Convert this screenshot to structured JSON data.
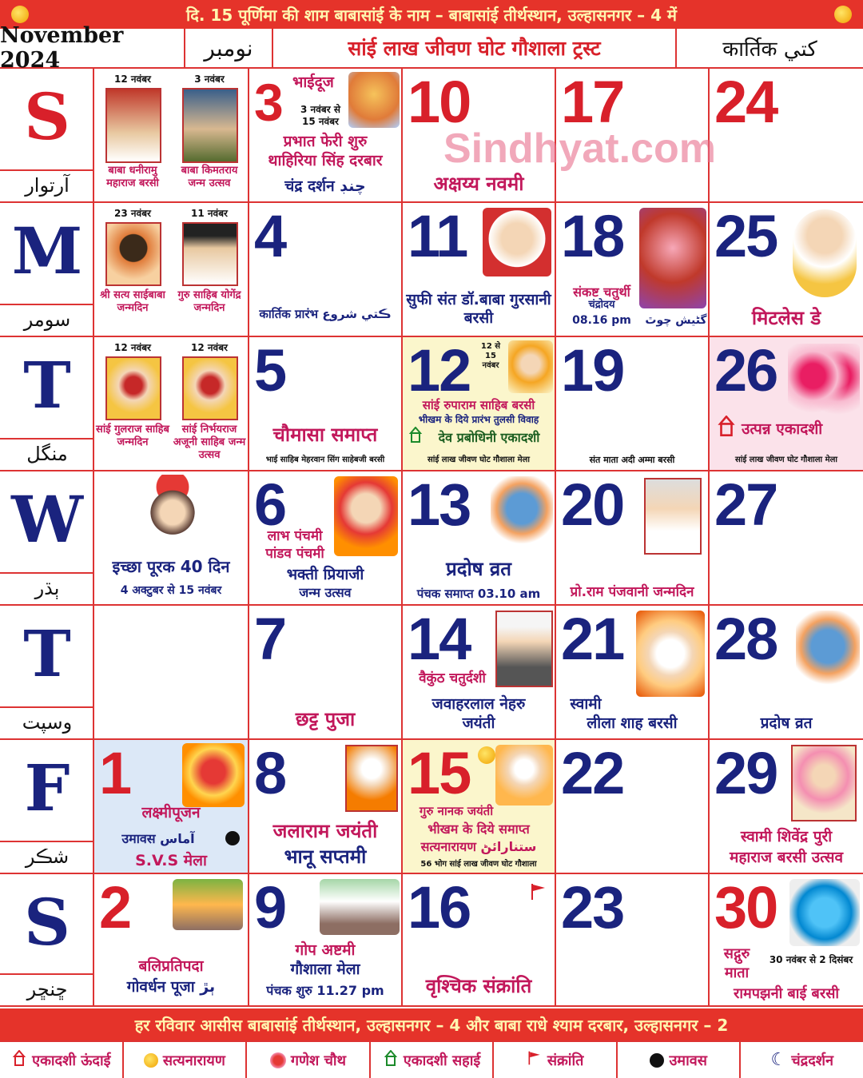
{
  "top_banner": "दि. 15 पूर्णिमा की शाम बाबासांई के नाम – बाबासांई तीर्थस्थान, उल्हासनगर – 4 में",
  "header": {
    "month": "November 2024",
    "month_urdu": "نومبر",
    "trust": "सांई लाख जीवण घोट गौशाला ट्रस्ट",
    "kartik": "कार्तिक كتي"
  },
  "watermark": "Sindhyat.com",
  "days": [
    {
      "letter": "S",
      "urdu": "آرتوار",
      "color": "#d8202a"
    },
    {
      "letter": "M",
      "urdu": "سومر",
      "color": "#1a237e"
    },
    {
      "letter": "T",
      "urdu": "منگل",
      "color": "#1a237e"
    },
    {
      "letter": "W",
      "urdu": "ٻڌر",
      "color": "#1a237e"
    },
    {
      "letter": "T",
      "urdu": "وسپت",
      "color": "#1a237e"
    },
    {
      "letter": "F",
      "urdu": "شڪر",
      "color": "#1a237e"
    },
    {
      "letter": "S",
      "urdu": "ڇنڇر",
      "color": "#1a237e"
    }
  ],
  "minis": {
    "sun": [
      {
        "date": "12 नवंबर",
        "caption": "बाबा धनीरामु महाराज बरसी"
      },
      {
        "date": "3 नवंबर",
        "caption": "बाबा किमतराय जन्म उत्सव"
      }
    ],
    "mon": [
      {
        "date": "23 नवंबर",
        "caption": "श्री सत्य साईबाबा जन्मदिन"
      },
      {
        "date": "11 नवंबर",
        "caption": "गुरु साहिब योगेंद्र जन्मदिन"
      }
    ],
    "tue": [
      {
        "date": "12 नवंबर",
        "caption": "सांई गुलराज साहिब जन्मदिन"
      },
      {
        "date": "12 नवंबर",
        "caption": "सांई निर्भयराज अजूनी साहिब जन्म उत्सव"
      }
    ]
  },
  "cells": {
    "d3": {
      "num": "3",
      "a": "भाईदूज",
      "b": "3 नवंबर से 15 नवंबर",
      "c": "प्रभात फेरी शुरु",
      "d": "थाहिरिया सिंह दरबार",
      "e": "चंद्र दर्शन چنڊ"
    },
    "d10": {
      "num": "10",
      "a": "अक्षय्य नवमी"
    },
    "d17": {
      "num": "17"
    },
    "d24": {
      "num": "24"
    },
    "d4": {
      "num": "4",
      "a": "कार्तिक प्रारंभ ڪتي شروع"
    },
    "d11": {
      "num": "11",
      "a": "सुफी संत डॉ.बाबा गुरसानी बरसी"
    },
    "d18": {
      "num": "18",
      "a": "संकष्ट चतुर्थी",
      "b": "चंद्रोदय",
      "c": "08.16 pm",
      "d": "گڻيش چوٿ"
    },
    "d25": {
      "num": "25",
      "a": "मिटलेस डे"
    },
    "d5": {
      "num": "5",
      "a": "चौमासा समाप्त",
      "b": "भाई साहिब मेहरवान सिंग साहेबजी बरसी"
    },
    "d12": {
      "num": "12",
      "sub": "12 से 15 नवंबर",
      "a": "सांई रुपाराम साहिब बरसी",
      "b": "भीखम के दिये प्रारंभ तुलसी विवाह",
      "c": "देव प्रबोधिनी एकादशी",
      "d": "सांई लाख जीवण घोट गौशाला मेला"
    },
    "d19": {
      "num": "19",
      "a": "संत माता अदी अम्मा बरसी"
    },
    "d26": {
      "num": "26",
      "a": "उत्पन्न एकादशी",
      "b": "सांई लाख जीवण घोट गौशाला मेला"
    },
    "wmini": {
      "a": "इच्छा पूरक 40 दिन",
      "b": "4 अक्टुबर से 15 नवंबर"
    },
    "d6": {
      "num": "6",
      "a": "लाभ पंचमी",
      "b": "पांडव पंचमी",
      "c": "भक्ती प्रियाजी",
      "d": "जन्म उत्सव"
    },
    "d13": {
      "num": "13",
      "a": "प्रदोष व्रत",
      "b": "पंचक समाप्त 03.10 am"
    },
    "d20": {
      "num": "20",
      "a": "प्रो.राम पंजवानी जन्मदिन"
    },
    "d27": {
      "num": "27"
    },
    "d7": {
      "num": "7",
      "a": "छट्ट पुजा"
    },
    "d14": {
      "num": "14",
      "a": "वैकुंठ चतुर्दशी",
      "b": "जवाहरलाल नेहरु",
      "c": "जयंती"
    },
    "d21": {
      "num": "21",
      "a": "स्वामी",
      "b": "लीला शाह बरसी"
    },
    "d28": {
      "num": "28",
      "a": "प्रदोष व्रत"
    },
    "d1": {
      "num": "1",
      "a": "लक्ष्मीपूजन",
      "b": "उमावस آماس",
      "c": "S.V.S मेला"
    },
    "d8": {
      "num": "8",
      "a": "जलाराम जयंती",
      "b": "भानू सप्तमी"
    },
    "d15": {
      "num": "15",
      "a": "गुरु नानक जयंती",
      "b": "भीखम के दिये समाप्त",
      "c": "सत्यनारायण ستنارائڻ",
      "d": "56 भोग सांई लाख जीवण घोट गौशाला"
    },
    "d22": {
      "num": "22"
    },
    "d29": {
      "num": "29",
      "a": "स्वामी शिवेंद्र पुरी",
      "b": "महाराज बरसी उत्सव"
    },
    "d2": {
      "num": "2",
      "a": "बलिप्रतिपदा",
      "b": "गोवर्धन पूजा ٻڙ"
    },
    "d9": {
      "num": "9",
      "a": "गोप अष्टमी",
      "b": "गौशाला मेला",
      "c": "पंचक शुरु 11.27 pm"
    },
    "d16": {
      "num": "16",
      "a": "वृश्चिक संक्रांति"
    },
    "d23": {
      "num": "23"
    },
    "d30": {
      "num": "30",
      "a": "सद्गुरु",
      "b": "30 नवंबर से 2 दिसंबर",
      "c": "माता",
      "d": "रामपझनी बाई बरसी"
    }
  },
  "bottom_banner": "हर रविवार आसीस बाबासांई तीर्थस्थान, उल्हासनगर – 4 और बाबा राधे श्याम दरबार, उल्हासनगर – 2",
  "legend": [
    {
      "label": "एकादशी ऊंदाई",
      "icon": "temple-red-icon"
    },
    {
      "label": "सत्यनारायण",
      "icon": "sun-icon"
    },
    {
      "label": "गणेश चौथ",
      "icon": "ganesh-icon"
    },
    {
      "label": "एकादशी सहाई",
      "icon": "temple-green-icon"
    },
    {
      "label": "संक्रांति",
      "icon": "flag-icon"
    },
    {
      "label": "उमावस",
      "icon": "black-dot-icon"
    },
    {
      "label": "चंद्रदर्शन",
      "icon": "moon-icon"
    }
  ],
  "colors": {
    "accent": "#d8202a",
    "navy": "#1a237e",
    "magenta": "#c2185b"
  }
}
